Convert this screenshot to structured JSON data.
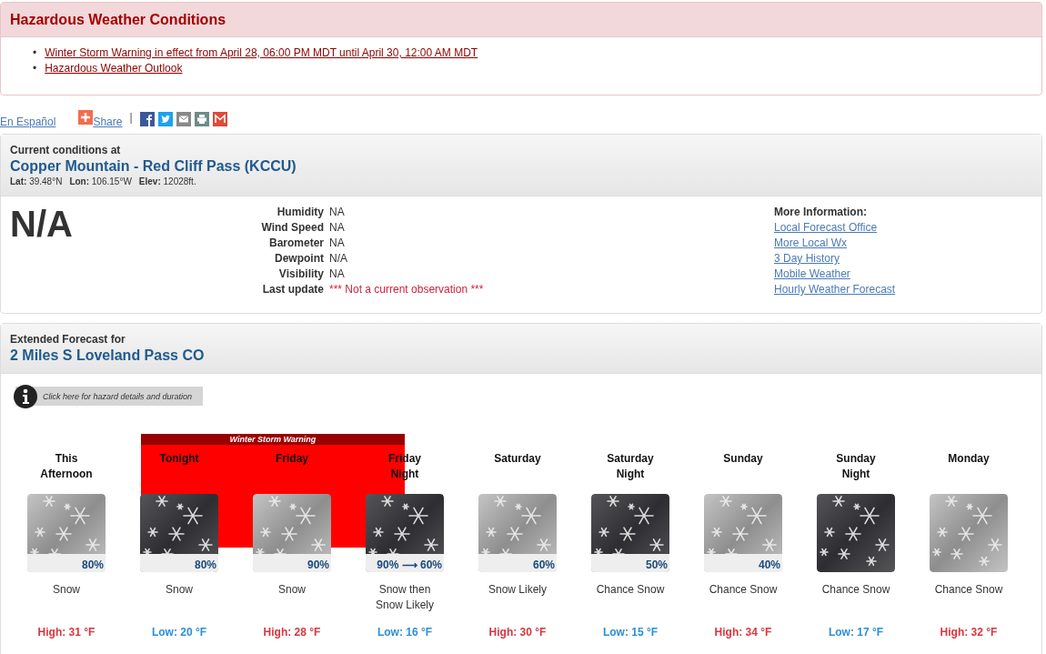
{
  "hazards": {
    "title": "Hazardous Weather Conditions",
    "links": [
      {
        "bullet": "•",
        "text": "Winter Storm Warning in effect from April 28, 06:00 PM MDT until April 30, 12:00 AM MDT"
      },
      {
        "bullet": "•",
        "text": "Hazardous Weather Outlook"
      }
    ]
  },
  "share_bar": {
    "language_link": "En Español",
    "share_link": "Share",
    "separator": "|",
    "icons": [
      {
        "kind": "facebook"
      },
      {
        "kind": "twitter"
      },
      {
        "kind": "email"
      },
      {
        "kind": "print"
      },
      {
        "kind": "gmail"
      }
    ]
  },
  "current_conditions": {
    "heading": "Current conditions at",
    "station": "Copper Mountain - Red Cliff Pass (KCCU)",
    "coords": [
      {
        "label": "Lat:",
        "value": "39.48°N"
      },
      {
        "label": "Lon:",
        "value": "106.15°W"
      },
      {
        "label": "Elev:",
        "value": "12028ft."
      }
    ],
    "temperature": "N/A",
    "details": [
      {
        "label": "Humidity",
        "value": "NA",
        "alert": false
      },
      {
        "label": "Wind Speed",
        "value": "NA",
        "alert": false
      },
      {
        "label": "Barometer",
        "value": "NA",
        "alert": false
      },
      {
        "label": "Dewpoint",
        "value": "N/A",
        "alert": false
      },
      {
        "label": "Visibility",
        "value": "NA",
        "alert": false
      },
      {
        "label": "Last update",
        "value": "*** Not a current observation ***",
        "alert": true
      }
    ],
    "more_info": {
      "title": "More Information:",
      "links": [
        "Local Forecast Office",
        "More Local Wx",
        "3 Day History",
        "Mobile Weather",
        "Hourly Weather Forecast"
      ]
    }
  },
  "extended_forecast": {
    "heading": "Extended Forecast for",
    "location": "2 Miles S Loveland Pass CO",
    "hazard_button": "Click here for hazard details and duration",
    "warning_label": "Winter Storm Warning",
    "periods": [
      {
        "name": "This Afternoon",
        "kind": "day",
        "in_warning": false,
        "pop": "80%",
        "description": "Snow",
        "temp": "High: 31 °F"
      },
      {
        "name": "Tonight",
        "kind": "night",
        "in_warning": true,
        "pop": "80%",
        "description": "Snow",
        "temp": "Low: 20 °F"
      },
      {
        "name": "Friday",
        "kind": "day",
        "in_warning": true,
        "pop": "90%",
        "description": "Snow",
        "temp": "High: 28 °F"
      },
      {
        "name": "Friday Night",
        "kind": "night",
        "in_warning": true,
        "pop": "90% ⟶ 60%",
        "description": "Snow then Snow Likely",
        "temp": "Low: 16 °F"
      },
      {
        "name": "Saturday",
        "kind": "day",
        "in_warning": false,
        "pop": "60%",
        "description": "Snow Likely",
        "temp": "High: 30 °F"
      },
      {
        "name": "Saturday Night",
        "kind": "night",
        "in_warning": false,
        "pop": "50%",
        "description": "Chance Snow",
        "temp": "Low: 15 °F"
      },
      {
        "name": "Sunday",
        "kind": "day",
        "in_warning": false,
        "pop": "40%",
        "description": "Chance Snow",
        "temp": "High: 34 °F"
      },
      {
        "name": "Sunday Night",
        "kind": "night",
        "in_warning": false,
        "description": "Chance Snow",
        "temp": "Low: 17 °F"
      },
      {
        "name": "Monday",
        "kind": "day",
        "in_warning": false,
        "description": "Chance Snow",
        "temp": "High: 32 °F"
      }
    ]
  }
}
